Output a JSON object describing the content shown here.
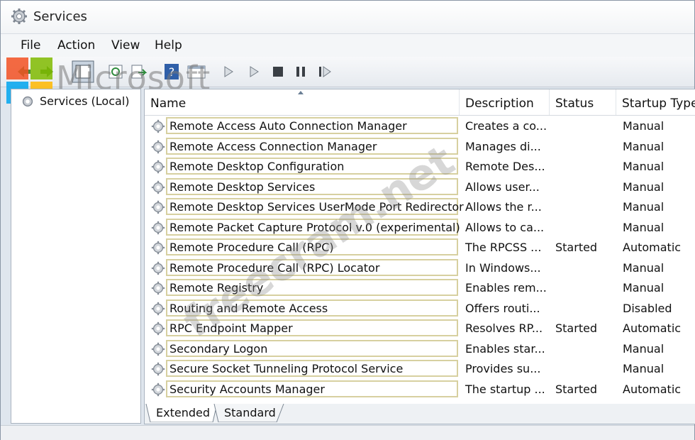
{
  "window": {
    "title": "Services"
  },
  "menu": [
    "File",
    "Action",
    "View",
    "Help"
  ],
  "toolbar_icons": [
    "back-arrow-icon",
    "forward-arrow-icon",
    "console-tree-icon",
    "refresh-icon",
    "export-icon",
    "help-icon",
    "properties-icon",
    "start-icon",
    "start-service-icon",
    "stop-service-icon",
    "pause-service-icon",
    "restart-service-icon"
  ],
  "watermarks": {
    "brand": "Microsoft",
    "site": "freecram.net"
  },
  "brand_colors": [
    "#f25022",
    "#7fba00",
    "#00a4ef",
    "#ffb900"
  ],
  "tree": {
    "root_label": "Services (Local)"
  },
  "columns": {
    "name": "Name",
    "description": "Description",
    "status": "Status",
    "startup": "Startup Type"
  },
  "services": [
    {
      "name": "Remote Access Auto Connection Manager",
      "description": "Creates a co...",
      "status": "",
      "startup": "Manual"
    },
    {
      "name": "Remote Access Connection Manager",
      "description": "Manages di...",
      "status": "",
      "startup": "Manual"
    },
    {
      "name": "Remote Desktop Configuration",
      "description": "Remote Des...",
      "status": "",
      "startup": "Manual"
    },
    {
      "name": "Remote Desktop Services",
      "description": "Allows user...",
      "status": "",
      "startup": "Manual"
    },
    {
      "name": "Remote Desktop Services UserMode Port Redirector",
      "description": "Allows the r...",
      "status": "",
      "startup": "Manual"
    },
    {
      "name": "Remote Packet Capture Protocol v.0 (experimental)",
      "description": "Allows to ca...",
      "status": "",
      "startup": "Manual"
    },
    {
      "name": "Remote Procedure Call (RPC)",
      "description": "The RPCSS ...",
      "status": "Started",
      "startup": "Automatic"
    },
    {
      "name": "Remote Procedure Call (RPC) Locator",
      "description": "In Windows...",
      "status": "",
      "startup": "Manual"
    },
    {
      "name": "Remote Registry",
      "description": "Enables rem...",
      "status": "",
      "startup": "Manual"
    },
    {
      "name": "Routing and Remote Access",
      "description": "Offers routi...",
      "status": "",
      "startup": "Disabled"
    },
    {
      "name": "RPC Endpoint Mapper",
      "description": "Resolves RP...",
      "status": "Started",
      "startup": "Automatic"
    },
    {
      "name": "Secondary Logon",
      "description": "Enables star...",
      "status": "",
      "startup": "Manual"
    },
    {
      "name": "Secure Socket Tunneling Protocol Service",
      "description": "Provides su...",
      "status": "",
      "startup": "Manual"
    },
    {
      "name": "Security Accounts Manager",
      "description": "The startup ...",
      "status": "Started",
      "startup": "Automatic"
    }
  ],
  "tabs": [
    "Extended",
    "Standard"
  ]
}
